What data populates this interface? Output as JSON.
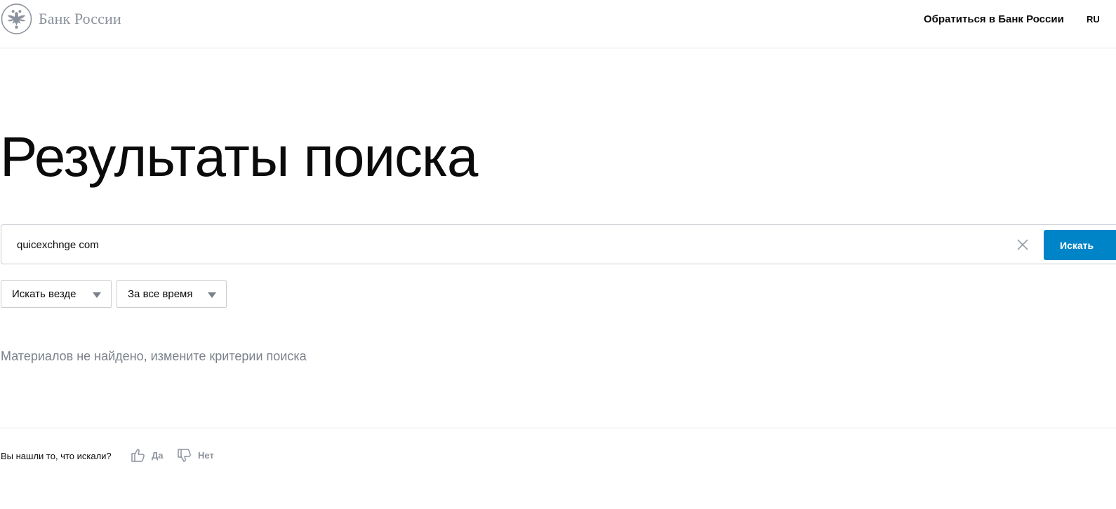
{
  "header": {
    "logo_text": "Банк России",
    "contact_link": "Обратиться в Банк России",
    "language": "RU"
  },
  "page": {
    "title": "Результаты поиска"
  },
  "search": {
    "value": "quicexchnge com",
    "button_label": "Искать"
  },
  "filters": {
    "where": "Искать везде",
    "period": "За все время"
  },
  "results": {
    "empty_message": "Материалов не найдено, измените критерии поиска"
  },
  "feedback": {
    "question": "Вы нашли то, что искали?",
    "yes_label": "Да",
    "no_label": "Нет"
  },
  "icons": {
    "logo": "bank-of-russia-eagle-emblem",
    "clear": "close-icon",
    "dropdown": "caret-down-icon",
    "yes": "thumb-up-icon",
    "no": "thumb-down-icon"
  },
  "colors": {
    "accent": "#0084c8",
    "muted_text": "#7b818b",
    "logo_gray": "#8b919c"
  }
}
